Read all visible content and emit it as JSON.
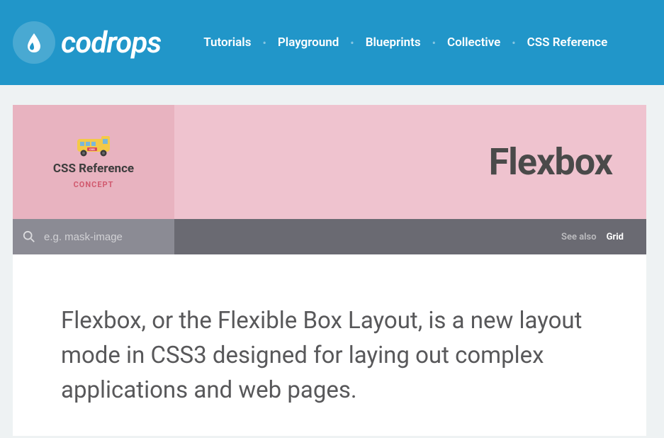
{
  "header": {
    "logo_text": "codrops",
    "nav": [
      "Tutorials",
      "Playground",
      "Blueprints",
      "Collective",
      "CSS Reference"
    ]
  },
  "sidebar": {
    "title": "CSS Reference",
    "subtitle": "CONCEPT"
  },
  "page": {
    "title": "Flexbox"
  },
  "search": {
    "placeholder": "e.g. mask-image"
  },
  "seealso": {
    "label": "See also",
    "link": "Grid"
  },
  "content": {
    "intro": "Flexbox, or the Flexible Box Layout, is a new layout mode in CSS3 designed for laying out complex applications and web pages."
  }
}
